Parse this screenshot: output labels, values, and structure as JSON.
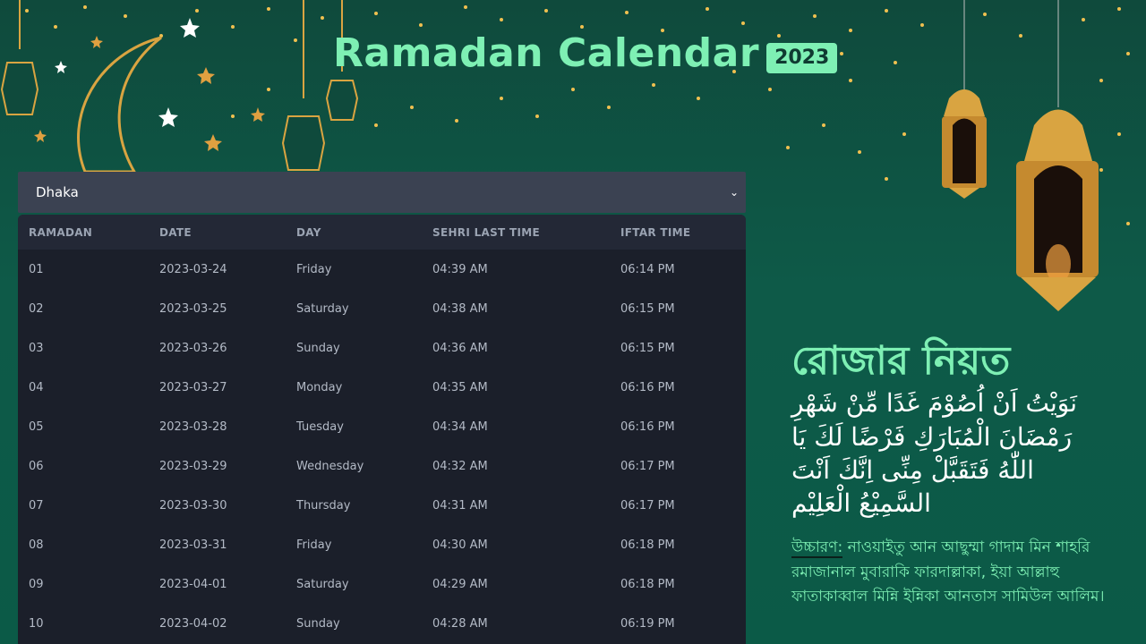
{
  "header": {
    "title": "Ramadan Calendar",
    "year": "2023"
  },
  "district_select": {
    "selected": "Dhaka"
  },
  "table": {
    "columns": [
      "RAMADAN",
      "DATE",
      "DAY",
      "SEHRI LAST TIME",
      "IFTAR TIME"
    ],
    "rows": [
      [
        "01",
        "2023-03-24",
        "Friday",
        "04:39 AM",
        "06:14 PM"
      ],
      [
        "02",
        "2023-03-25",
        "Saturday",
        "04:38 AM",
        "06:15 PM"
      ],
      [
        "03",
        "2023-03-26",
        "Sunday",
        "04:36 AM",
        "06:15 PM"
      ],
      [
        "04",
        "2023-03-27",
        "Monday",
        "04:35 AM",
        "06:16 PM"
      ],
      [
        "05",
        "2023-03-28",
        "Tuesday",
        "04:34 AM",
        "06:16 PM"
      ],
      [
        "06",
        "2023-03-29",
        "Wednesday",
        "04:32 AM",
        "06:17 PM"
      ],
      [
        "07",
        "2023-03-30",
        "Thursday",
        "04:31 AM",
        "06:17 PM"
      ],
      [
        "08",
        "2023-03-31",
        "Friday",
        "04:30 AM",
        "06:18 PM"
      ],
      [
        "09",
        "2023-04-01",
        "Saturday",
        "04:29 AM",
        "06:18 PM"
      ],
      [
        "10",
        "2023-04-02",
        "Sunday",
        "04:28 AM",
        "06:19 PM"
      ]
    ]
  },
  "niyat": {
    "title": "রোজার নিয়ত",
    "arabic": "نَوَيْتُ اَنْ اُصُوْمَ غَدًا مِّنْ شَهْرِ رَمْضَانَ الْمُبَارَكِ فَرْضًا لَكَ يَا اللّٰهُ فَتَقَبَّلْ مِنِّى اِنَّكَ اَنْتَ السَّمِيْعُ الْعَلِيْم",
    "pronunciation_label": "উচ্চারণ:",
    "pronunciation": "নাওয়াইতু আন আছুম্মা গাদাম মিন শাহরি রমাজানাল মুবারাকি ফারদাল্লাকা, ইয়া আল্লাহু ফাতাকাব্বাল মিন্নি ইন্নিকা আনতাস সামিউল আলিম।"
  },
  "colors": {
    "accent": "#7ef0b4",
    "background": "#0e5a48",
    "table_bg": "#1b1f2a",
    "select_bg": "#3b4252",
    "lantern_gold": "#d9a441"
  },
  "icons": [
    "crescent-moon-icon",
    "lantern-icon",
    "star-icon",
    "chevron-down-icon"
  ]
}
